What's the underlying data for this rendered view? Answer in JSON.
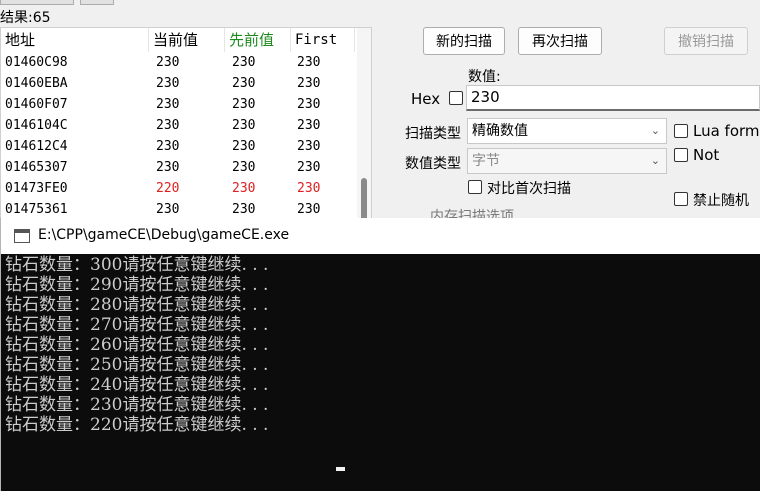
{
  "scan": {
    "results_label": "结果:65",
    "columns": [
      "地址",
      "当前值",
      "先前值",
      "First"
    ],
    "rows": [
      {
        "address": "01460C98",
        "current": "230",
        "previous": "230",
        "first": "230",
        "changed": false
      },
      {
        "address": "01460EBA",
        "current": "230",
        "previous": "230",
        "first": "230",
        "changed": false
      },
      {
        "address": "01460F07",
        "current": "230",
        "previous": "230",
        "first": "230",
        "changed": false
      },
      {
        "address": "0146104C",
        "current": "230",
        "previous": "230",
        "first": "230",
        "changed": false
      },
      {
        "address": "014612C4",
        "current": "230",
        "previous": "230",
        "first": "230",
        "changed": false
      },
      {
        "address": "01465307",
        "current": "230",
        "previous": "230",
        "first": "230",
        "changed": false
      },
      {
        "address": "01473FE0",
        "current": "220",
        "previous": "230",
        "first": "230",
        "changed": true
      },
      {
        "address": "01475361",
        "current": "230",
        "previous": "230",
        "first": "230",
        "changed": false
      }
    ],
    "buttons": {
      "new_scan": "新的扫描",
      "next_scan": "再次扫描",
      "undo_scan": "撤销扫描"
    },
    "value_label": "数值:",
    "hex_label": "Hex",
    "value": "230",
    "scan_type_label": "扫描类型",
    "scan_type_value": "精确数值",
    "value_type_label": "数值类型",
    "value_type_value": "字节",
    "compare_first_label": "对比首次扫描",
    "lua_formula_label": "Lua formu",
    "not_label": "Not",
    "disable_random_label": "禁止随机",
    "memory_options_label": "内存扫描选项"
  },
  "console": {
    "title": "E:\\CPP\\gameCE\\Debug\\gameCE.exe",
    "lines": [
      "钻石数量：300请按任意键继续. . .",
      "钻石数量：290请按任意键继续. . .",
      "钻石数量：280请按任意键继续. . .",
      "钻石数量：270请按任意键继续. . .",
      "钻石数量：260请按任意键继续. . .",
      "钻石数量：250请按任意键继续. . .",
      "钻石数量：240请按任意键继续. . .",
      "钻石数量：230请按任意键继续. . .",
      "钻石数量：220请按任意键继续. . ."
    ]
  },
  "colors": {
    "changed_value": "#e02020",
    "previous_header": "#1f8a1f",
    "console_bg": "#0c0c0c",
    "console_text": "#cccccc"
  }
}
